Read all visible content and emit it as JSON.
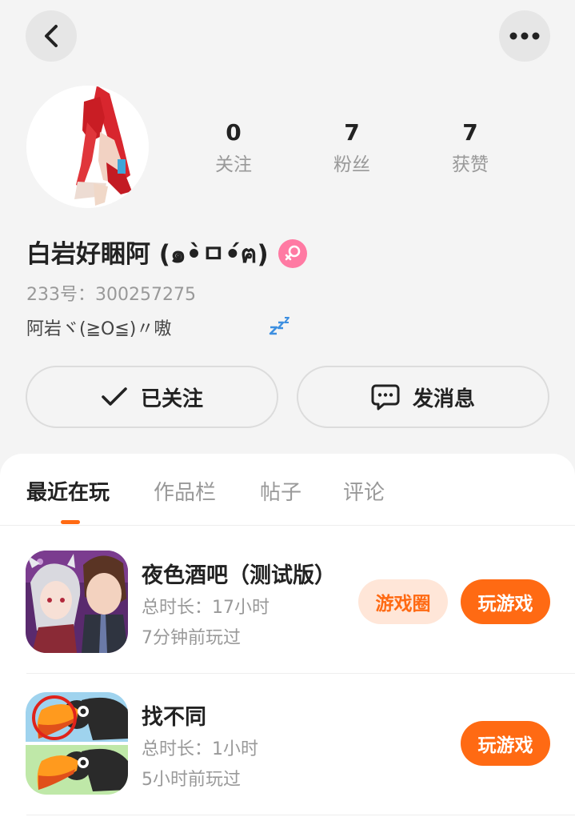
{
  "header": {
    "back_icon": "chevron-left-icon",
    "more_icon": "more-dots-icon"
  },
  "stats": [
    {
      "value": "0",
      "label": "关注"
    },
    {
      "value": "7",
      "label": "粉丝"
    },
    {
      "value": "7",
      "label": "获赞"
    }
  ],
  "profile": {
    "username": "白岩好睏阿 (๑•̀ㅁ•́ฅ)",
    "gender_icon": "female-icon",
    "uid": "233号：300257275",
    "bio": "阿岩ヾ(≧O≦)〃嗷",
    "bio_icon": "zzz-icon"
  },
  "actions": {
    "follow_label": "已关注",
    "message_label": "发消息"
  },
  "tabs": [
    {
      "label": "最近在玩",
      "active": true
    },
    {
      "label": "作品栏",
      "active": false
    },
    {
      "label": "帖子",
      "active": false
    },
    {
      "label": "评论",
      "active": false
    }
  ],
  "games": [
    {
      "title": "夜色酒吧（测试版）",
      "duration": "总时长：17小时",
      "last_played": "7分钟前玩过",
      "circle_label": "游戏圈",
      "play_label": "玩游戏"
    },
    {
      "title": "找不同",
      "duration": "总时长：1小时",
      "last_played": "5小时前玩过",
      "play_label": "玩游戏"
    }
  ],
  "colors": {
    "accent": "#ff6a13",
    "accent_light": "#ffe6d8",
    "female": "#ff7aa3",
    "background": "#f4f4f4"
  }
}
